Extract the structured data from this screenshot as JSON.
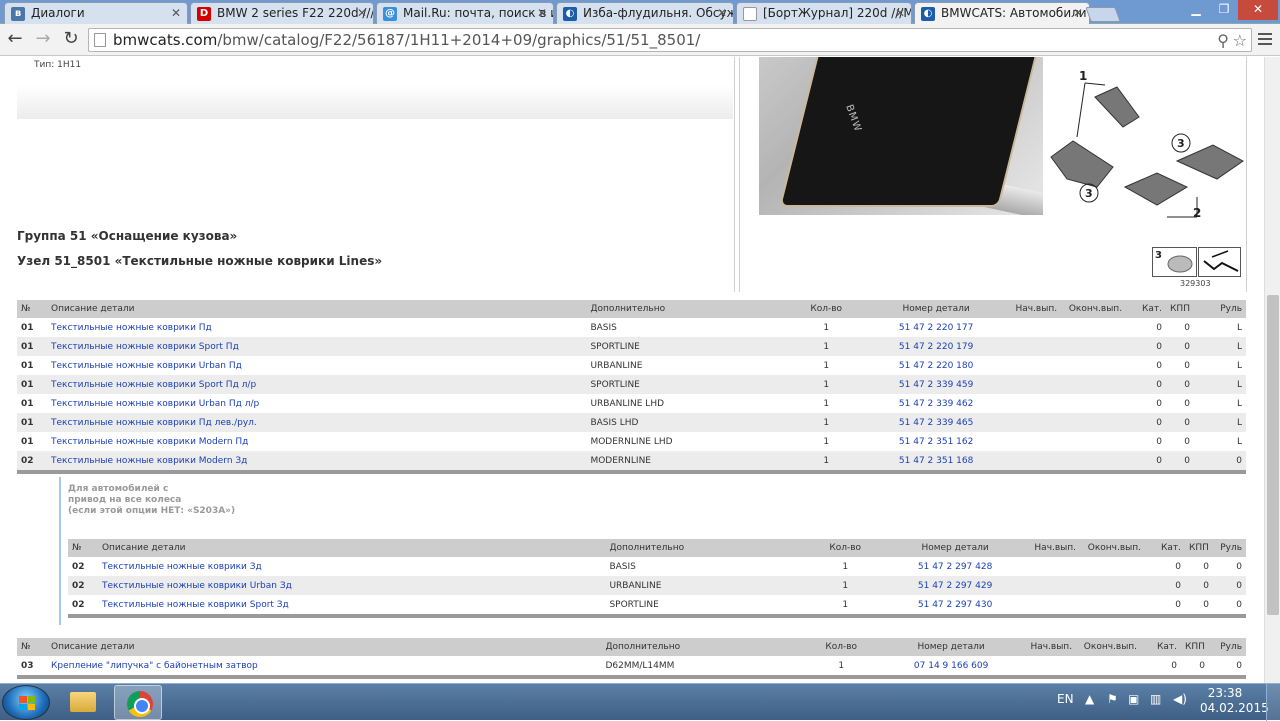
{
  "browser": {
    "tabs": [
      {
        "label": "Диалоги",
        "favicon": "vk-icon",
        "color": "#4a76a8",
        "glyph": "в"
      },
      {
        "label": "BMW 2 series F22 220d ///",
        "favicon": "drive2-icon",
        "color": "#d40000",
        "glyph": "D"
      },
      {
        "label": "Mail.Ru: почта, поиск в и",
        "favicon": "mailru-icon",
        "color": "#3a8fd8",
        "glyph": "@"
      },
      {
        "label": "Изба-флудильня. Обсуж",
        "favicon": "bmw-icon",
        "color": "#1c5ca8",
        "glyph": "◐"
      },
      {
        "label": "[БортЖурнал] 220d ///M",
        "favicon": "page-icon",
        "color": "#999999",
        "glyph": ""
      },
      {
        "label": "BMWCATS: Автомобили",
        "favicon": "bmw-icon",
        "color": "#1c5ca8",
        "glyph": "◐"
      }
    ],
    "url_host": "bmwcats.com",
    "url_path": "/bmw/catalog/F22/56187/1H11+2014+09/graphics/51/51_8501/"
  },
  "page": {
    "type_line": "Тип: 1H11",
    "group_title": "Группа 51 «Оснащение кузова»",
    "node_title": "Узел 51_8501 «Текстильные ножные коврики Lines»",
    "diagram_labels": [
      "1",
      "2",
      "3",
      "3"
    ],
    "thumb_label": "3",
    "thumb_number": "329303",
    "photo_logo": "BMW"
  },
  "table_headers": [
    "№",
    "Описание детали",
    "Дополнительно",
    "Кол-во",
    "Номер детали",
    "Нач.вып.",
    "Оконч.вып.",
    "Кат.",
    "КПП",
    "Руль"
  ],
  "table1": [
    [
      "01",
      "Текстильные ножные коврики Пд",
      "BASIS",
      "1",
      "51 47 2 220 177",
      "",
      "",
      "0",
      "0",
      "L"
    ],
    [
      "01",
      "Текстильные ножные коврики Sport Пд",
      "SPORTLINE",
      "1",
      "51 47 2 220 179",
      "",
      "",
      "0",
      "0",
      "L"
    ],
    [
      "01",
      "Текстильные ножные коврики Urban Пд",
      "URBANLINE",
      "1",
      "51 47 2 220 180",
      "",
      "",
      "0",
      "0",
      "L"
    ],
    [
      "01",
      "Текстильные ножные коврики Sport Пд л/р",
      "SPORTLINE",
      "1",
      "51 47 2 339 459",
      "",
      "",
      "0",
      "0",
      "L"
    ],
    [
      "01",
      "Текстильные ножные коврики Urban Пд л/р",
      "URBANLINE LHD",
      "1",
      "51 47 2 339 462",
      "",
      "",
      "0",
      "0",
      "L"
    ],
    [
      "01",
      "Текстильные ножные коврики Пд лев./рул.",
      "BASIS LHD",
      "1",
      "51 47 2 339 465",
      "",
      "",
      "0",
      "0",
      "L"
    ],
    [
      "01",
      "Текстильные ножные коврики Modern Пд",
      "MODERNLINE LHD",
      "1",
      "51 47 2 351 162",
      "",
      "",
      "0",
      "0",
      "L"
    ],
    [
      "02",
      "Текстильные ножные коврики Modern Зд",
      "MODERNLINE",
      "1",
      "51 47 2 351 168",
      "",
      "",
      "0",
      "0",
      "0"
    ]
  ],
  "note_lines": [
    "Для автомобилей с",
    "привод на все колеса",
    "(если этой опции НЕТ: «S203A»)"
  ],
  "table2": [
    [
      "02",
      "Текстильные ножные коврики Зд",
      "BASIS",
      "1",
      "51 47 2 297 428",
      "",
      "",
      "0",
      "0",
      "0"
    ],
    [
      "02",
      "Текстильные ножные коврики Urban Зд",
      "URBANLINE",
      "1",
      "51 47 2 297 429",
      "",
      "",
      "0",
      "0",
      "0"
    ],
    [
      "02",
      "Текстильные ножные коврики Sport Зд",
      "SPORTLINE",
      "1",
      "51 47 2 297 430",
      "",
      "",
      "0",
      "0",
      "0"
    ]
  ],
  "table3": [
    [
      "03",
      "Крепление \"липучка\" с байонетным затвор",
      "D62MM/L14MM",
      "1",
      "07 14 9 166 609",
      "",
      "",
      "0",
      "0",
      "0"
    ]
  ],
  "taskbar": {
    "language": "EN",
    "time": "23:38",
    "date": "04.02.2015"
  },
  "colors": {
    "link": "#1a3fb8",
    "header_bg": "#cdcdcd",
    "row_alt": "#ececec",
    "tabbar": "#6e9ad1"
  }
}
